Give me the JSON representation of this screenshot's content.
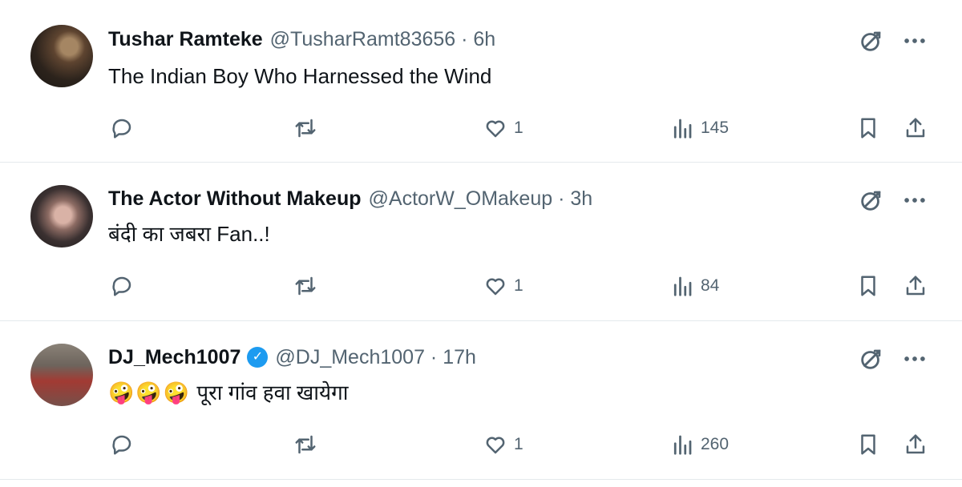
{
  "tweets": [
    {
      "name": "Tushar Ramteke",
      "handle_time": "@TusharRamt83656 · 6h",
      "verified": false,
      "text": "The Indian  Boy Who Harnessed the Wind",
      "emojis": [],
      "likes": "1",
      "views": "145"
    },
    {
      "name": "The Actor Without Makeup",
      "handle_time": "@ActorW_OMakeup · 3h",
      "verified": false,
      "text": "बंदी का जबरा Fan..!",
      "emojis": [],
      "likes": "1",
      "views": "84"
    },
    {
      "name": "DJ_Mech1007",
      "handle_time": "@DJ_Mech1007 · 17h",
      "verified": true,
      "text": "पूरा गांव हवा खायेगा",
      "emojis": [
        "🤪",
        "🤪",
        "🤪"
      ],
      "likes": "1",
      "views": "260"
    }
  ],
  "icons": {
    "reply": "reply-icon",
    "repost": "repost-icon",
    "like": "heart-icon",
    "views": "views-icon",
    "bookmark": "bookmark-icon",
    "share": "share-icon",
    "grok": "grok-icon",
    "more": "more-icon"
  },
  "colors": {
    "text": "#0f1419",
    "secondary": "#536471",
    "verified": "#1d9bf0",
    "divider": "#e4e9ec"
  }
}
